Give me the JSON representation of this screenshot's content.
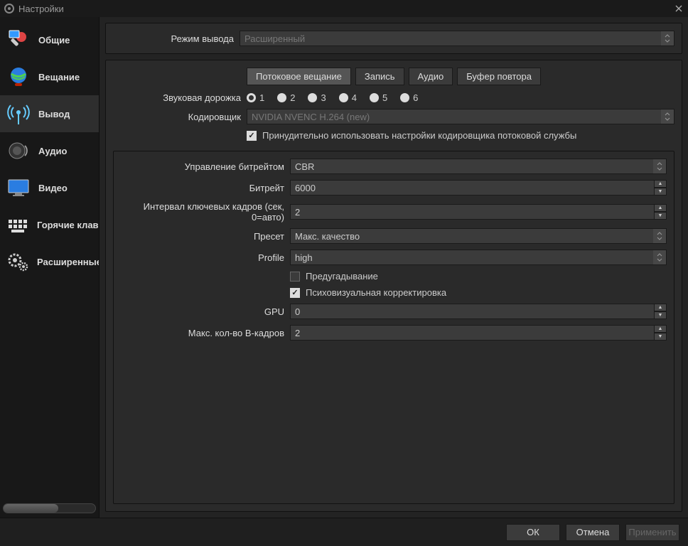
{
  "window": {
    "title": "Настройки"
  },
  "sidebar": {
    "items": [
      {
        "label": "Общие"
      },
      {
        "label": "Вещание"
      },
      {
        "label": "Вывод"
      },
      {
        "label": "Аудио"
      },
      {
        "label": "Видео"
      },
      {
        "label": "Горячие клавиши"
      },
      {
        "label": "Расширенные"
      }
    ],
    "selected_index": 2
  },
  "output": {
    "mode_label": "Режим вывода",
    "mode_value": "Расширенный",
    "tabs": {
      "streaming": "Потоковое вещание",
      "recording": "Запись",
      "audio": "Аудио",
      "replay": "Буфер повтора"
    },
    "streaming": {
      "audio_track_label": "Звуковая дорожка",
      "tracks": [
        "1",
        "2",
        "3",
        "4",
        "5",
        "6"
      ],
      "track_selected": 0,
      "encoder_label": "Кодировщик",
      "encoder_value": "NVIDIA NVENC H.264 (new)",
      "enforce_label": "Принудительно использовать настройки кодировщика потоковой службы",
      "enforce_checked": true,
      "rate_control_label": "Управление битрейтом",
      "rate_control_value": "CBR",
      "bitrate_label": "Битрейт",
      "bitrate_value": "6000",
      "keyint_label": "Интервал ключевых кадров (сек, 0=авто)",
      "keyint_value": "2",
      "preset_label": "Пресет",
      "preset_value": "Макс. качество",
      "profile_label": "Profile",
      "profile_value": "high",
      "lookahead_label": "Предугадывание",
      "lookahead_checked": false,
      "psycho_label": "Психовизуальная корректировка",
      "psycho_checked": true,
      "gpu_label": "GPU",
      "gpu_value": "0",
      "bframes_label": "Макс. кол-во B-кадров",
      "bframes_value": "2"
    }
  },
  "footer": {
    "ok": "ОК",
    "cancel": "Отмена",
    "apply": "Применить"
  }
}
